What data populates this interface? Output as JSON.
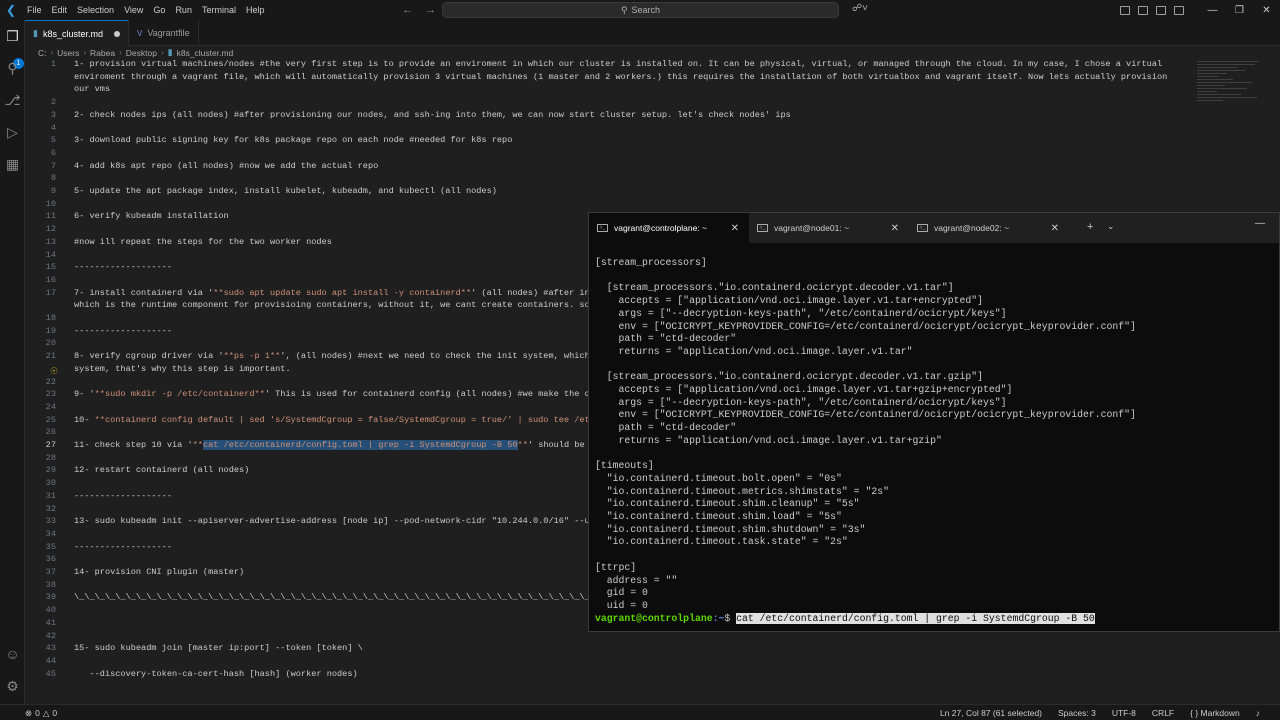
{
  "menu": [
    "File",
    "Edit",
    "Selection",
    "View",
    "Go",
    "Run",
    "Terminal",
    "Help"
  ],
  "command_center": {
    "label": "Search"
  },
  "tabs": [
    {
      "label": "k8s_cluster.md",
      "active": true,
      "modified": true
    },
    {
      "label": "Vagrantfile",
      "active": false,
      "modified": false
    }
  ],
  "breadcrumb": [
    "C:",
    "Users",
    "Rabea",
    "Desktop",
    "k8s_cluster.md"
  ],
  "activity_badge": "1",
  "editor": {
    "lines": [
      {
        "n": "1",
        "text": "1- provision virtual machines/nodes #the very first step is to provide an enviroment in which our cluster is installed on. It can be physical, virtual, or managed through the cloud. In my case, I chose a virtual"
      },
      {
        "n": "",
        "text": "enviroment through a vagrant file, which will automatically provision 3 virtual machines (1 master and 2 workers.) this requires the installation of both virtualbox and vagrant itself. Now lets actually provision"
      },
      {
        "n": "",
        "text": "our vms"
      },
      {
        "n": "2",
        "text": ""
      },
      {
        "n": "3",
        "text": "2- check nodes ips (all nodes) #after provisioning our nodes, and ssh-ing into them, we can now start cluster setup. let's check nodes' ips"
      },
      {
        "n": "4",
        "text": ""
      },
      {
        "n": "5",
        "text": "3- download public signing key for k8s package repo on each node #needed for k8s repo"
      },
      {
        "n": "6",
        "text": ""
      },
      {
        "n": "7",
        "text": "4- add k8s apt repo (all nodes) #now we add the actual repo"
      },
      {
        "n": "8",
        "text": ""
      },
      {
        "n": "9",
        "text": "5- update the apt package index, install kubelet, kubeadm, and kubectl (all nodes)"
      },
      {
        "n": "10",
        "text": ""
      },
      {
        "n": "11",
        "text": "6- verify kubeadm installation"
      },
      {
        "n": "12",
        "text": ""
      },
      {
        "n": "13",
        "text": "#now ill repeat the steps for the two worker nodes"
      },
      {
        "n": "14",
        "text": ""
      },
      {
        "n": "15",
        "text": "-------------------"
      },
      {
        "n": "16",
        "text": ""
      },
      {
        "n": "17",
        "text": "7- install containerd via '",
        "str": "**sudo apt update sudo apt install -y containerd**",
        "after": "' (all nodes) #after in"
      },
      {
        "n": "",
        "text": "which is the runtime component for provisioing containers, without it, we cant create containers. so"
      },
      {
        "n": "18",
        "text": ""
      },
      {
        "n": "19",
        "text": "-------------------"
      },
      {
        "n": "20",
        "text": ""
      },
      {
        "n": "21",
        "text": "8- verify cgroup driver via '",
        "str": "**ps -p 1**",
        "after": "', (all nodes) #next we need to check the init system, which"
      },
      {
        "n": "",
        "text": "system, that's why this step is important."
      },
      {
        "n": "22",
        "text": ""
      },
      {
        "n": "23",
        "text": "9- '",
        "str": "**sudo mkdir -p /etc/containerd**",
        "after": "' This is used for containerd config (all nodes) #we make the c"
      },
      {
        "n": "24",
        "text": ""
      },
      {
        "n": "25",
        "text": "10- ",
        "str": "**containerd config default | sed 's/SystemdCgroup = false/SystemdCgroup = true/' | sudo tee /et",
        "after": ""
      },
      {
        "n": "26",
        "text": ""
      },
      {
        "n": "27",
        "text": "11- check step 10 via '",
        "str": "**",
        "sel": "cat /etc/containerd/config.toml | grep -i SystemdCgroup -B 50",
        "str2": "**",
        "after": "' should be"
      },
      {
        "n": "28",
        "text": ""
      },
      {
        "n": "29",
        "text": "12- restart containerd (all nodes)"
      },
      {
        "n": "30",
        "text": ""
      },
      {
        "n": "31",
        "text": "-------------------"
      },
      {
        "n": "32",
        "text": ""
      },
      {
        "n": "33",
        "text": "13- sudo kubeadm init --apiserver-advertise-address [node ip] --pod-network-cidr \"10.244.0.0/16\" --u"
      },
      {
        "n": "34",
        "text": ""
      },
      {
        "n": "35",
        "text": "-------------------"
      },
      {
        "n": "36",
        "text": ""
      },
      {
        "n": "37",
        "text": "14- provision CNI plugin (master)"
      },
      {
        "n": "38",
        "text": ""
      },
      {
        "n": "39",
        "text": "\\_\\_\\_\\_\\_\\_\\_\\_\\_\\_\\_\\_\\_\\_\\_\\_\\_\\_\\_\\_\\_\\_\\_\\_\\_\\_\\_\\_\\_\\_\\_\\_\\_\\_\\_\\_\\_\\_\\_\\_\\_\\_\\_\\_\\_\\_\\_\\_\\_\\_\\_\\_\\__"
      },
      {
        "n": "40",
        "text": ""
      },
      {
        "n": "41",
        "text": ""
      },
      {
        "n": "42",
        "text": ""
      },
      {
        "n": "43",
        "text": "15- sudo kubeadm join [master ip:port] --token [token] \\"
      },
      {
        "n": "44",
        "text": ""
      },
      {
        "n": "45",
        "text": "   --discovery-token-ca-cert-hash [hash] (worker nodes)"
      }
    ]
  },
  "terminal": {
    "tabs": [
      {
        "label": "vagrant@controlplane: ~",
        "active": true
      },
      {
        "label": "vagrant@node01: ~",
        "active": false
      },
      {
        "label": "vagrant@node02: ~",
        "active": false
      }
    ],
    "lines": [
      "[stream_processors]",
      "",
      "  [stream_processors.\"io.containerd.ocicrypt.decoder.v1.tar\"]",
      "    accepts = [\"application/vnd.oci.image.layer.v1.tar+encrypted\"]",
      "    args = [\"--decryption-keys-path\", \"/etc/containerd/ocicrypt/keys\"]",
      "    env = [\"OCICRYPT_KEYPROVIDER_CONFIG=/etc/containerd/ocicrypt/ocicrypt_keyprovider.conf\"]",
      "    path = \"ctd-decoder\"",
      "    returns = \"application/vnd.oci.image.layer.v1.tar\"",
      "",
      "  [stream_processors.\"io.containerd.ocicrypt.decoder.v1.tar.gzip\"]",
      "    accepts = [\"application/vnd.oci.image.layer.v1.tar+gzip+encrypted\"]",
      "    args = [\"--decryption-keys-path\", \"/etc/containerd/ocicrypt/keys\"]",
      "    env = [\"OCICRYPT_KEYPROVIDER_CONFIG=/etc/containerd/ocicrypt/ocicrypt_keyprovider.conf\"]",
      "    path = \"ctd-decoder\"",
      "    returns = \"application/vnd.oci.image.layer.v1.tar+gzip\"",
      "",
      "[timeouts]",
      "  \"io.containerd.timeout.bolt.open\" = \"0s\"",
      "  \"io.containerd.timeout.metrics.shimstats\" = \"2s\"",
      "  \"io.containerd.timeout.shim.cleanup\" = \"5s\"",
      "  \"io.containerd.timeout.shim.load\" = \"5s\"",
      "  \"io.containerd.timeout.shim.shutdown\" = \"3s\"",
      "  \"io.containerd.timeout.task.state\" = \"2s\"",
      "",
      "[ttrpc]",
      "  address = \"\"",
      "  gid = 0",
      "  uid = 0"
    ],
    "prompt": {
      "user": "vagrant@controlplane",
      "path": ":~",
      "symbol": "$ ",
      "command": "cat /etc/containerd/config.toml | grep -i SystemdCgroup -B 50"
    }
  },
  "status": {
    "errors": "0",
    "warnings": "0",
    "position": "Ln 27, Col 87 (61 selected)",
    "spaces": "Spaces: 3",
    "encoding": "UTF-8",
    "eol": "CRLF",
    "language": "Markdown"
  },
  "colors": {
    "accent": "#0078d4",
    "string": "#ce9178",
    "selection": "#264f78",
    "prompt_user": "#5fd700",
    "prompt_path": "#5f87ff"
  }
}
